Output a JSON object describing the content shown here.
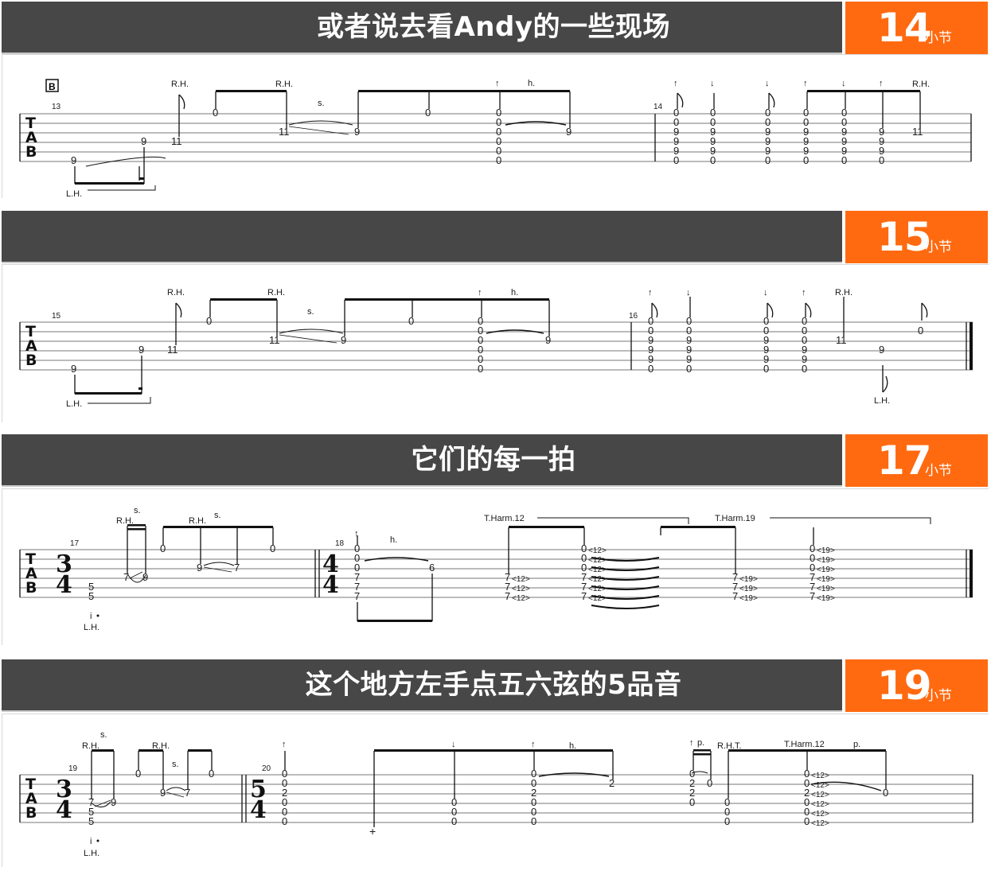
{
  "sections": [
    {
      "title": "或者说去看Andy的一些现场",
      "measure": "14",
      "unit": "小节"
    },
    {
      "title": "",
      "measure": "15",
      "unit": "小节"
    },
    {
      "title": "它们的每一拍",
      "measure": "17",
      "unit": "小节"
    },
    {
      "title": "这个地方左手点五六弦的5品音",
      "measure": "19",
      "unit": "小节"
    }
  ],
  "tab_clef": {
    "t": "T",
    "a": "A",
    "b": "B"
  },
  "notation": {
    "rh": "R.H.",
    "lh": "L.H.",
    "slide": "s.",
    "hammer": "h.",
    "pull": "p.",
    "rht": "R.H.T.",
    "up": "↑",
    "down": "↓",
    "tharm12": "T.Harm.12",
    "tharm19": "T.Harm.19",
    "section_mark": "B",
    "plus": "+"
  },
  "staff1": {
    "bar_nums": [
      "13",
      "14"
    ],
    "notes": [
      "9",
      "9",
      "11",
      "0",
      "11",
      "9",
      "0",
      "0",
      "0",
      "0",
      "0",
      "0",
      "9",
      "0",
      "0",
      "9",
      "9",
      "9",
      "0",
      "0",
      "0",
      "9",
      "9",
      "9",
      "0",
      "0",
      "0",
      "9",
      "9",
      "9",
      "0",
      "0",
      "0",
      "9",
      "9",
      "9",
      "0",
      "0",
      "0",
      "9",
      "9",
      "9",
      "0",
      "9",
      "9",
      "0",
      "11"
    ]
  },
  "staff2": {
    "bar_nums": [
      "15",
      "16"
    ],
    "notes": [
      "9",
      "9",
      "11",
      "0",
      "11",
      "9",
      "0",
      "0",
      "0",
      "0",
      "0",
      "0",
      "9",
      "0",
      "0",
      "9",
      "9",
      "9",
      "0",
      "0",
      "0",
      "9",
      "9",
      "9",
      "0",
      "0",
      "0",
      "9",
      "9",
      "9",
      "0",
      "0",
      "0",
      "9",
      "9",
      "9",
      "0",
      "11",
      "9",
      "0"
    ]
  },
  "staff3": {
    "bar_nums": [
      "17",
      "18"
    ],
    "ts1": [
      "3",
      "4"
    ],
    "ts2": [
      "4",
      "4"
    ],
    "notes": [
      "5",
      "5",
      "7",
      "9",
      "0",
      "9",
      "7",
      "0",
      "0",
      "0",
      "0",
      "7",
      "7",
      "7",
      "6",
      "7",
      "7",
      "7",
      "0",
      "0",
      "0",
      "7",
      "7",
      "7",
      "7",
      "7",
      "7",
      "0",
      "0",
      "0",
      "7",
      "7",
      "7"
    ],
    "harm_labels": [
      "<12>",
      "<19>"
    ]
  },
  "staff4": {
    "bar_nums": [
      "19",
      "20"
    ],
    "ts1": [
      "3",
      "4"
    ],
    "ts2": [
      "5",
      "4"
    ],
    "notes": [
      "7",
      "5",
      "5",
      "9",
      "0",
      "9",
      "7",
      "0",
      "0",
      "0",
      "2",
      "0",
      "0",
      "0",
      "0",
      "0",
      "0",
      "0",
      "0",
      "2",
      "0",
      "0",
      "2",
      "0",
      "2",
      "0",
      "2",
      "0",
      "0",
      "0",
      "0",
      "0",
      "0",
      "2",
      "0",
      "0",
      "0",
      "0"
    ]
  }
}
